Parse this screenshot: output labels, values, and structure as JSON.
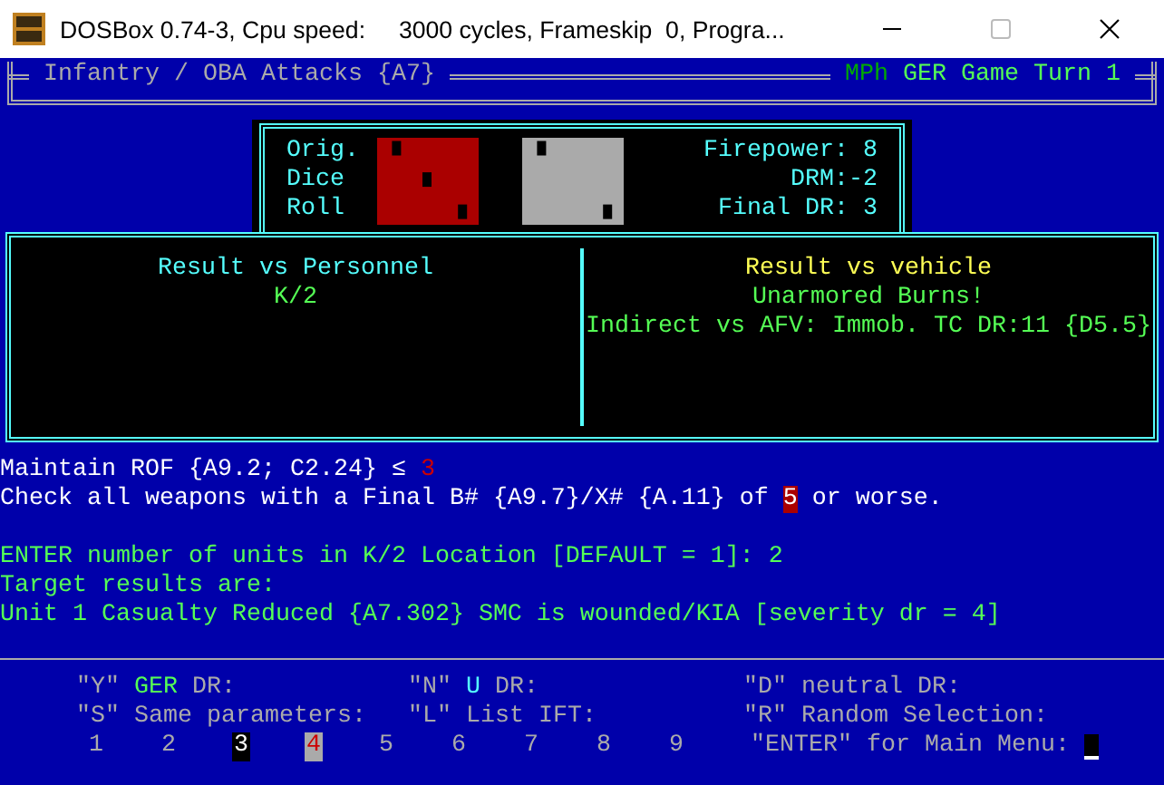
{
  "window": {
    "title": "DOSBox 0.74-3, Cpu speed:     3000 cycles, Frameskip  0, Progra..."
  },
  "header": {
    "title": "Infantry / OBA Attacks {A7}",
    "phase": "MPh",
    "turn": "GER Game Turn 1"
  },
  "dice_panel": {
    "labels": [
      "Orig.",
      "Dice",
      "Roll"
    ],
    "dice": [
      {
        "color": "#aa0000",
        "kind": "three"
      },
      {
        "color": "#aaaaaa",
        "kind": "two"
      }
    ],
    "stats": [
      "Firepower: 8",
      "DRM:-2",
      "Final DR: 3"
    ]
  },
  "results": {
    "personnel": {
      "heading": "Result vs Personnel",
      "lines": [
        "K/2"
      ]
    },
    "vehicle": {
      "heading": "Result vs vehicle",
      "lines": [
        "Unarmored Burns!",
        "Indirect vs AFV: Immob. TC DR:11 {D5.5}"
      ]
    }
  },
  "rof_notes": [
    [
      {
        "text": "Maintain ROF {A9.2; C2.24} ≤ ",
        "kind": "plain"
      },
      {
        "text": "3",
        "kind": "alert"
      }
    ],
    [
      {
        "text": "Check all weapons with a Final B# {A9.7}/X# {A.11} of ",
        "kind": "plain"
      },
      {
        "text": "5",
        "kind": "boxed"
      },
      {
        "text": " or worse.",
        "kind": "plain"
      }
    ]
  ],
  "prompt_lines": [
    "ENTER number of units in K/2 Location [DEFAULT = 1]: 2",
    "Target results are:",
    "Unit 1 Casualty Reduced {A7.302} SMC is wounded/KIA [severity dr = 4]"
  ],
  "key_menu": {
    "options": [
      {
        "key": "\"Y\"",
        "side": "GER",
        "kind": "german",
        "label": "DR:"
      },
      {
        "key": "\"N\"",
        "side": "U",
        "kind": "allied",
        "label": "DR:"
      },
      {
        "key": "\"D\"",
        "label": "neutral DR:"
      },
      {
        "key": "\"S\"",
        "label": "Same parameters:"
      },
      {
        "key": "\"L\"",
        "label": "List IFT:"
      },
      {
        "key": "\"R\"",
        "label": "Random Selection:"
      }
    ],
    "numbers": [
      {
        "label": "1",
        "selected": false,
        "marked": false
      },
      {
        "label": "2",
        "selected": false,
        "marked": false
      },
      {
        "label": "3",
        "selected": true,
        "marked": false
      },
      {
        "label": "4",
        "selected": false,
        "marked": true
      },
      {
        "label": "5",
        "selected": false,
        "marked": false
      },
      {
        "label": "6",
        "selected": false,
        "marked": false
      },
      {
        "label": "7",
        "selected": false,
        "marked": false
      },
      {
        "label": "8",
        "selected": false,
        "marked": false
      },
      {
        "label": "9",
        "selected": false,
        "marked": false
      }
    ],
    "main_menu": "\"ENTER\" for Main Menu:"
  }
}
